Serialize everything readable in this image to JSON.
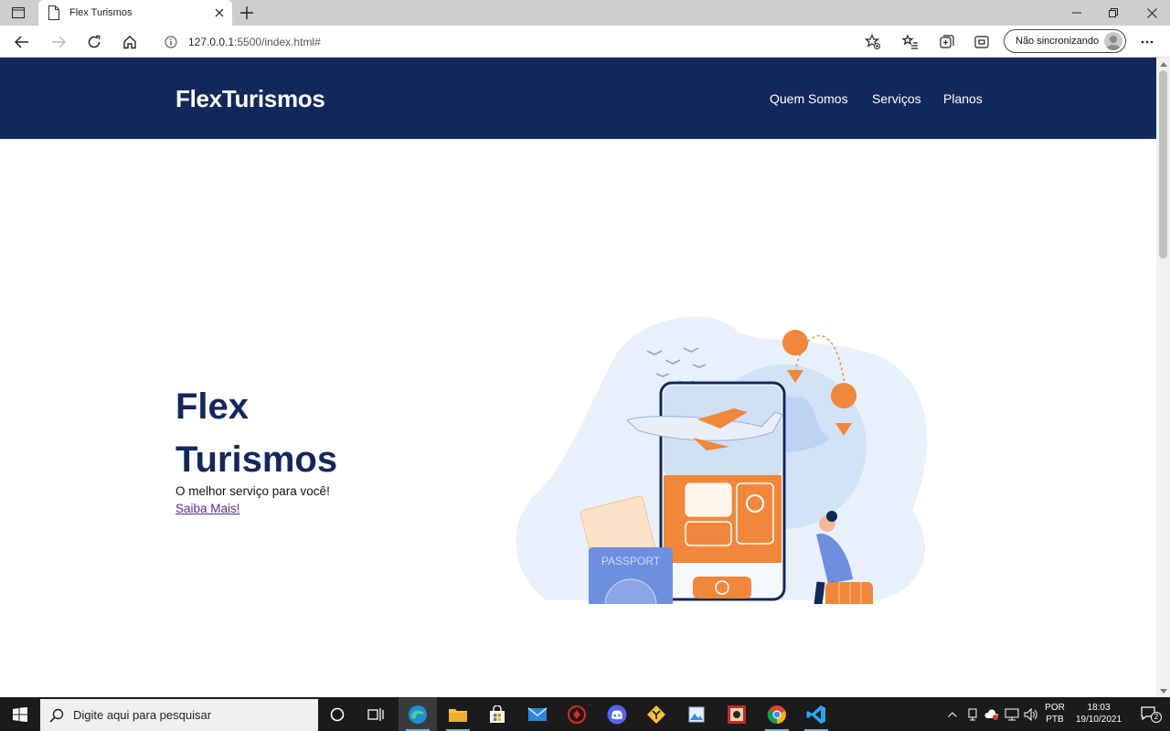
{
  "browser": {
    "tab_title": "Flex Turismos",
    "url_host": "127.0.0.1",
    "url_rest": ":5500/index.html#",
    "sync_label": "Não sincronizando"
  },
  "site": {
    "brand": "FlexTurismos",
    "nav": [
      "Quem Somos",
      "Serviços",
      "Planos"
    ]
  },
  "hero": {
    "title_line1": "Flex",
    "title_line2": "Turismos",
    "subtitle": "O melhor serviço para você!",
    "link": "Saiba Mais!",
    "illustration_text": "PASSPORT"
  },
  "taskbar": {
    "search_placeholder": "Digite aqui para pesquisar",
    "lang_line1": "POR",
    "lang_line2": "PTB",
    "time": "18:03",
    "date": "19/10/2021",
    "notifications": "2"
  },
  "colors": {
    "header_bg": "#13285a",
    "title_color": "#13285a",
    "accent_orange": "#f0873a",
    "link_color": "#5b2a86"
  }
}
